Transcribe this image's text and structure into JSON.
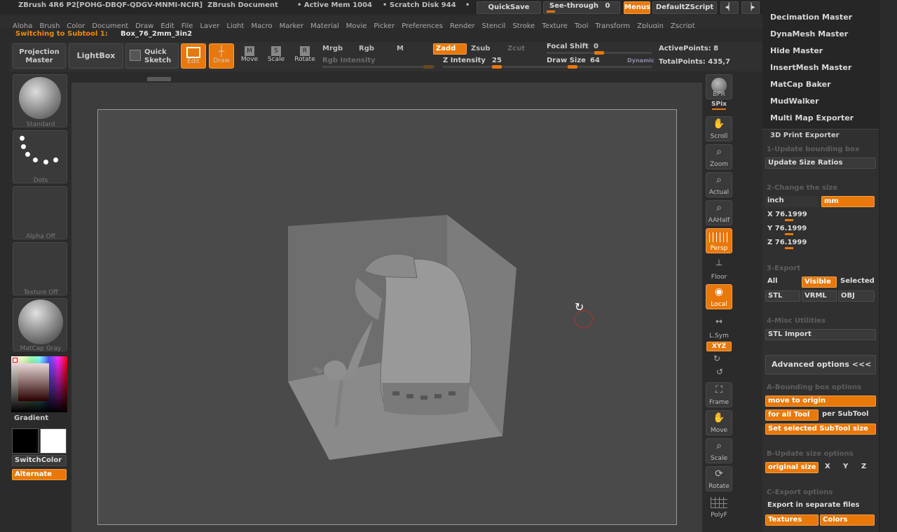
{
  "titlebar": {
    "app": "ZBrush 4R6 P2[POHG-DBQF-QDGV-MNMI-NCIR]",
    "document": "ZBrush Document",
    "active_mem": "• Active Mem 1004",
    "scratch_disk": "• Scratch Disk 944",
    "dot": "•",
    "quicksave": "QuickSave",
    "see_through_label": "See-through",
    "see_through_value": "0",
    "menus": "Menus",
    "default_zscript": "DefaultZScript"
  },
  "menubar": {
    "items": [
      "Alpha",
      "Brush",
      "Color",
      "Document",
      "Draw",
      "Edit",
      "File",
      "Layer",
      "Light",
      "Macro",
      "Marker",
      "Material",
      "Movie",
      "Picker",
      "Preferences",
      "Render",
      "Stencil",
      "Stroke",
      "Texture",
      "Tool",
      "Transform",
      "Zplugin",
      "Zscript"
    ]
  },
  "subtool_notice": {
    "label": "Switching to Subtool 1:",
    "name": "Box_76_2mm_3in2"
  },
  "toolbar": {
    "projection_master": "Projection Master",
    "lightbox": "LightBox",
    "quick_sketch": "Quick Sketch",
    "edit": "Edit",
    "draw": "Draw",
    "move": "Move",
    "scale": "Scale",
    "rotate": "Rotate",
    "mrgb": "Mrgb",
    "rgb": "Rgb",
    "m": "M",
    "zadd": "Zadd",
    "zsub": "Zsub",
    "zcut": "Zcut",
    "rgb_intensity": "Rgb Intensity",
    "z_intensity_label": "Z Intensity",
    "z_intensity_value": "25",
    "focal_shift_label": "Focal Shift",
    "focal_shift_value": "0",
    "draw_size_label": "Draw Size",
    "draw_size_value": "64",
    "dynamic": "Dynamic",
    "active_points": "ActivePoints: 8",
    "total_points": "TotalPoints: 435,7"
  },
  "left_shelf": {
    "brush": "Standard",
    "stroke": "Dots",
    "alpha": "Alpha Off",
    "texture": "Texture Off",
    "material": "MatCap Gray",
    "gradient": "Gradient",
    "switch_color": "SwitchColor",
    "alternate": "Alternate"
  },
  "right_shelf": {
    "bpr": "BPR",
    "spix": "SPix",
    "scroll": "Scroll",
    "zoom": "Zoom",
    "actual": "Actual",
    "aahalf": "AAHalf",
    "persp": "Persp",
    "floor": "Floor",
    "local": "Local",
    "lsym": "L.Sym",
    "xyz": "XYZ",
    "frame": "Frame",
    "move": "Move",
    "scale": "Scale",
    "rotate": "Rotate",
    "polyf": "PolyF"
  },
  "tray": {
    "plugins": [
      "Decimation Master",
      "DynaMesh Master",
      "Hide Master",
      "InsertMesh Master",
      "MatCap Baker",
      "MudWalker",
      "Multi Map Exporter"
    ],
    "panel_title": "3D Print Exporter",
    "s1": "1-Update bounding box",
    "update_size_ratios": "Update Size Ratios",
    "s2": "2-Change the size",
    "inch": "inch",
    "mm": "mm",
    "x": "X 76.1999",
    "y": "Y 76.1999",
    "z": "Z 76.1999",
    "s3": "3-Export",
    "all": "All",
    "visible": "Visible",
    "selected": "Selected",
    "stl": "STL",
    "vrml": "VRML",
    "obj": "OBJ",
    "s4": "4-Misc Utilities",
    "stl_import": "STL Import",
    "advanced": "Advanced options <<<",
    "sa": "A-Bounding box options",
    "move_to_origin": "move to origin",
    "for_all_tool": "for all Tool",
    "per_subtool": "per SubTool",
    "set_selected_subtool_size": "Set selected SubTool size",
    "sb": "B-Update size options",
    "original_size": "original size",
    "bx": "X",
    "by": "Y",
    "bz": "Z",
    "sc": "C-Export options",
    "export_separate": "Export in separate files",
    "textures": "Textures",
    "colors": "Colors"
  },
  "colors": {
    "accent": "#e8780a",
    "background": "#2b2b2b"
  }
}
